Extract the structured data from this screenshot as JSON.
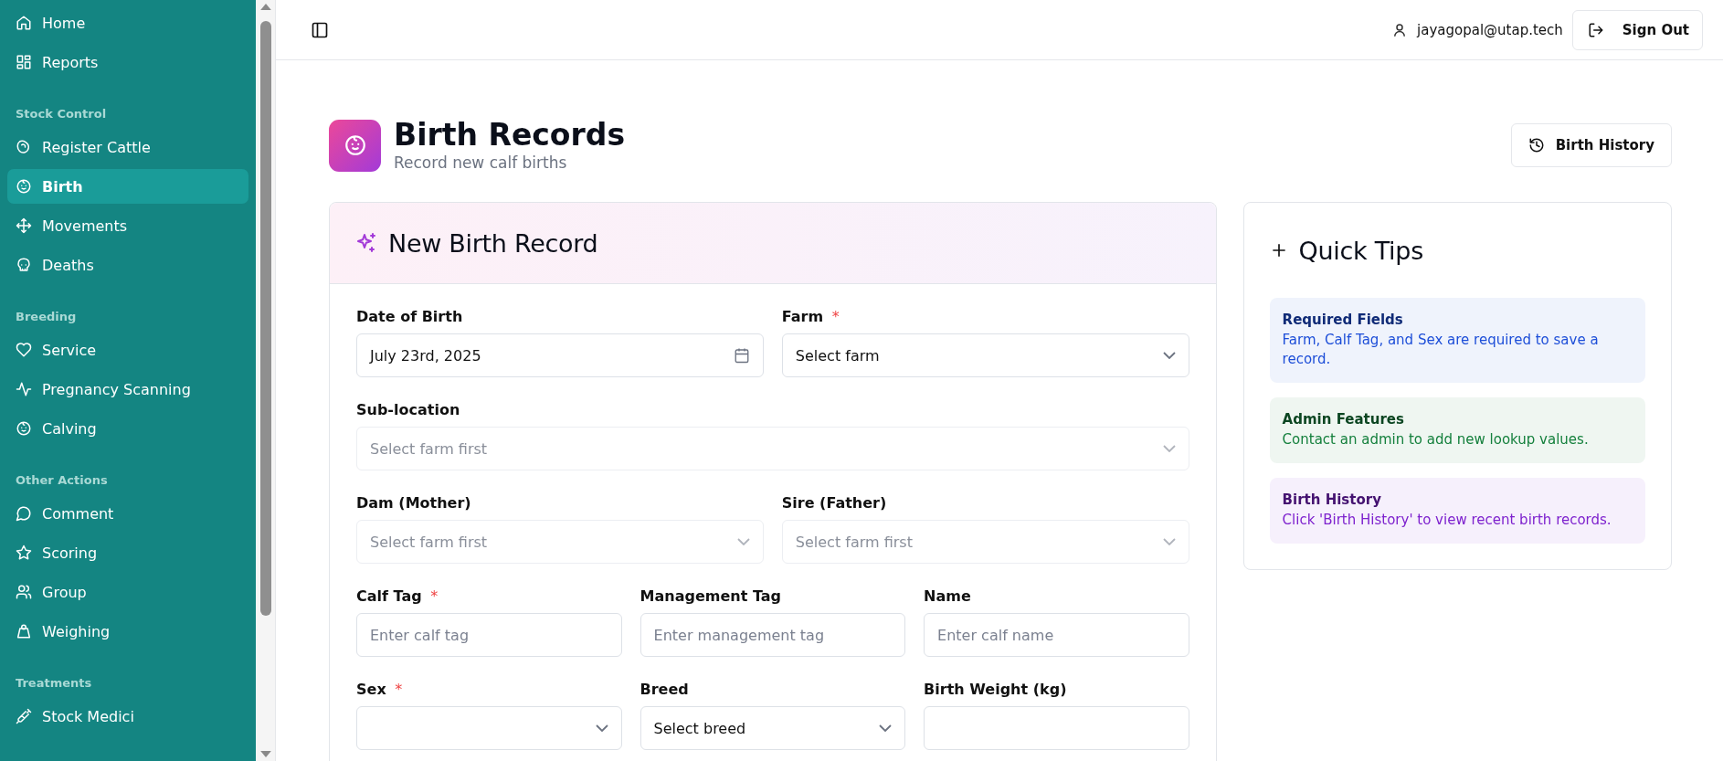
{
  "sidebar": {
    "sections": [
      {
        "items": [
          {
            "label": "Home",
            "selected": false
          },
          {
            "label": "Reports",
            "selected": false
          }
        ]
      },
      {
        "title": "Stock Control",
        "items": [
          {
            "label": "Register Cattle",
            "selected": false
          },
          {
            "label": "Birth",
            "selected": true
          },
          {
            "label": "Movements",
            "selected": false
          },
          {
            "label": "Deaths",
            "selected": false
          }
        ]
      },
      {
        "title": "Breeding",
        "items": [
          {
            "label": "Service",
            "selected": false
          },
          {
            "label": "Pregnancy Scanning",
            "selected": false
          },
          {
            "label": "Calving",
            "selected": false
          }
        ]
      },
      {
        "title": "Other Actions",
        "items": [
          {
            "label": "Comment",
            "selected": false
          },
          {
            "label": "Scoring",
            "selected": false
          },
          {
            "label": "Group",
            "selected": false
          },
          {
            "label": "Weighing",
            "selected": false
          }
        ]
      },
      {
        "title": "Treatments",
        "items": [
          {
            "label": "Stock Medici",
            "selected": false
          }
        ]
      }
    ]
  },
  "header": {
    "user": "jayagopal@utap.tech",
    "sign_out": "Sign Out"
  },
  "page": {
    "title": "Birth Records",
    "subtitle": "Record new calf births",
    "history_button": "Birth History"
  },
  "form": {
    "title": "New Birth Record",
    "rows": [
      [
        {
          "label": "Date of Birth",
          "kind": "date",
          "value": "July 23rd, 2025",
          "disabled": false
        },
        {
          "label": "Farm",
          "required_mark": "*",
          "kind": "select",
          "value": "Select farm",
          "disabled": false
        }
      ],
      [
        {
          "label": "Sub-location",
          "kind": "select",
          "placeholder": "Select farm first",
          "disabled": true
        }
      ],
      [
        {
          "label": "Dam (Mother)",
          "kind": "select",
          "placeholder": "Select farm first",
          "disabled": true
        },
        {
          "label": "Sire (Father)",
          "kind": "select",
          "placeholder": "Select farm first",
          "disabled": true
        }
      ],
      [
        {
          "label": "Calf Tag",
          "required_mark": "*",
          "kind": "text",
          "placeholder": "Enter calf tag"
        },
        {
          "label": "Management Tag",
          "kind": "text",
          "placeholder": "Enter management tag"
        },
        {
          "label": "Name",
          "kind": "text",
          "placeholder": "Enter calf name"
        }
      ],
      [
        {
          "label": "Sex",
          "required_mark": "*",
          "kind": "select",
          "disabled": false
        },
        {
          "label": "Breed",
          "kind": "select",
          "value": "Select breed",
          "disabled": false
        },
        {
          "label": "Birth Weight (kg)",
          "kind": "text"
        }
      ]
    ]
  },
  "tips": {
    "title": "Quick Tips",
    "items": [
      {
        "title": "Required Fields",
        "text": "Farm, Calf Tag, and Sex are required to save a record.",
        "color": "#1d4ed8"
      },
      {
        "title": "Admin Features",
        "text": "Contact an admin to add new lookup values.",
        "color": "#15803d"
      },
      {
        "title": "Birth History",
        "text": "Click 'Birth History' to view recent birth records.",
        "color": "#7e22ce"
      }
    ]
  }
}
